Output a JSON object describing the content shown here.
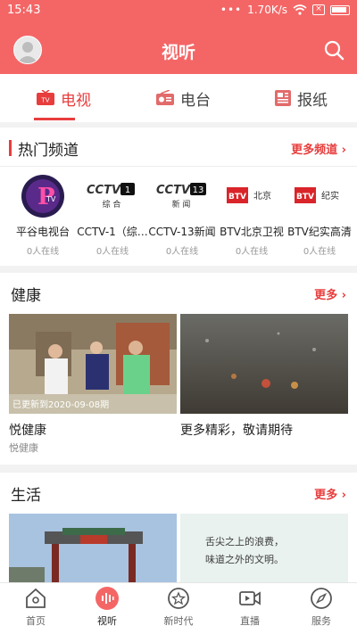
{
  "status": {
    "time": "15:43",
    "dots": "•••",
    "speed": "1.70K/s"
  },
  "header": {
    "title": "视听"
  },
  "tabs": [
    {
      "label": "电视"
    },
    {
      "label": "电台"
    },
    {
      "label": "报纸"
    }
  ],
  "hot": {
    "title": "热门频道",
    "more": "更多频道",
    "channels": [
      {
        "name": "平谷电视台",
        "sub": "0人在线"
      },
      {
        "name": "CCTV-1（综…",
        "sub": "0人在线",
        "logo_main": "CCTV",
        "logo_num": "1",
        "logo_sub": "综 合"
      },
      {
        "name": "CCTV-13新闻",
        "sub": "0人在线",
        "logo_main": "CCTV",
        "logo_num": "13",
        "logo_sub": "新 闻"
      },
      {
        "name": "BTV北京卫视",
        "sub": "0人在线",
        "logo_main": "BTV",
        "logo_sub": "北京"
      },
      {
        "name": "BTV纪实高清",
        "sub": "0人在线",
        "logo_main": "BTV",
        "logo_sub": "纪实"
      }
    ]
  },
  "health": {
    "title": "健康",
    "more": "更多",
    "cards": [
      {
        "title": "悦健康",
        "sub": "悦健康",
        "overlay": "已更新到2020-09-08期"
      },
      {
        "title": "更多精彩，敬请期待",
        "sub": ""
      }
    ]
  },
  "life": {
    "title": "生活",
    "more": "更多",
    "poem": [
      "舌尖之上的浪费，",
      "味道之外的文明。"
    ]
  },
  "nav": [
    {
      "label": "首页"
    },
    {
      "label": "视听"
    },
    {
      "label": "新时代"
    },
    {
      "label": "直播"
    },
    {
      "label": "服务"
    }
  ],
  "colors": {
    "brand": "#f46666",
    "accent": "#e83d3d"
  }
}
